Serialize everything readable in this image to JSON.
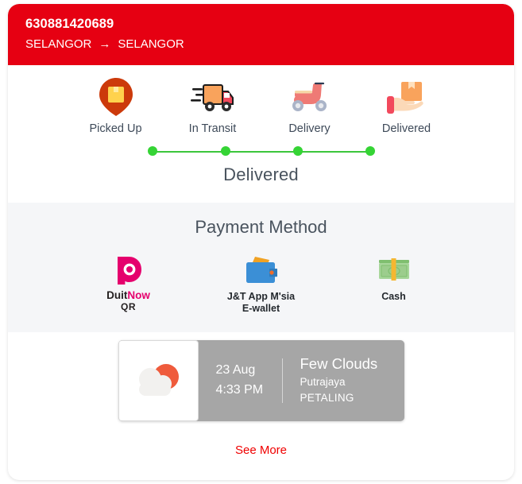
{
  "header": {
    "tracking_number": "630881420689",
    "origin": "SELANGOR",
    "destination": "SELANGOR",
    "arrow": "→",
    "bg_color": "#e60012"
  },
  "steps": [
    {
      "label": "Picked Up",
      "icon": "map-pin-package-icon"
    },
    {
      "label": "In Transit",
      "icon": "delivery-truck-icon"
    },
    {
      "label": "Delivery",
      "icon": "scooter-icon"
    },
    {
      "label": "Delivered",
      "icon": "hand-package-icon"
    }
  ],
  "progress": {
    "completed_dots": 4,
    "dot_color": "#35d435",
    "line_color": "#3cc63c",
    "status": "Delivered"
  },
  "payment": {
    "title": "Payment Method",
    "methods": [
      {
        "icon": "duitnow-qr-icon",
        "label_line1_part1": "Duit",
        "label_line1_part2": "Now",
        "label_line2": "QR",
        "label": "DuitNow QR"
      },
      {
        "icon": "wallet-icon",
        "label": "J&T App M'sia\nE-wallet",
        "label_line1": "J&T App M'sia",
        "label_line2": "E-wallet"
      },
      {
        "icon": "cash-banknotes-icon",
        "label": "Cash"
      }
    ]
  },
  "weather": {
    "icon": "sun-behind-cloud-icon",
    "date": "23 Aug",
    "time": "4:33 PM",
    "condition": "Few Clouds",
    "city": "Putrajaya",
    "district": "PETALING"
  },
  "footer": {
    "see_more": "See More",
    "link_color": "#f00000"
  }
}
